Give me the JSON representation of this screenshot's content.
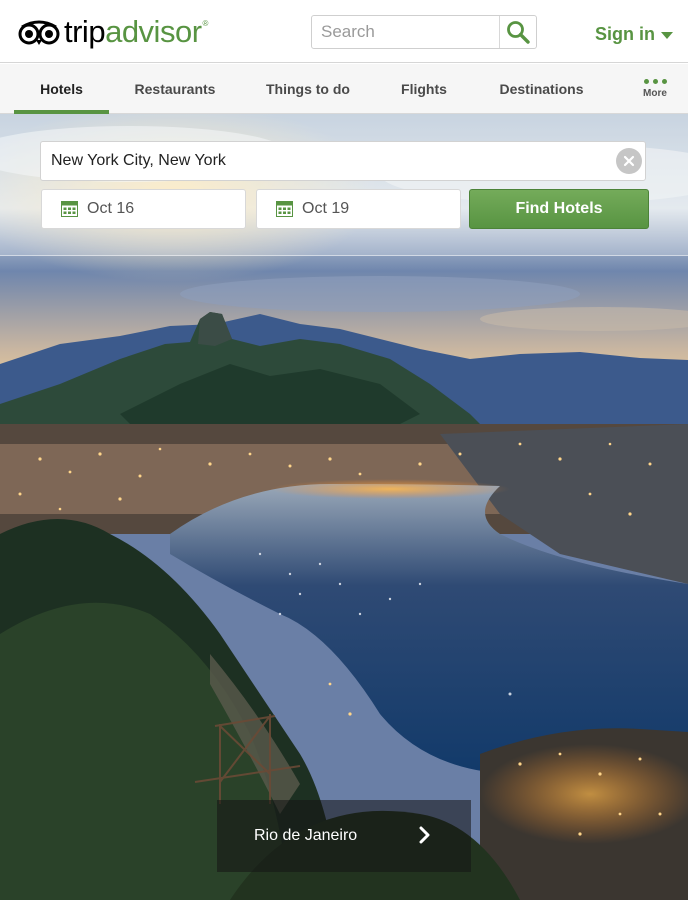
{
  "app": {
    "brand_trip": "trip",
    "brand_advisor": "advisor",
    "brand_mark": "®"
  },
  "header": {
    "search_placeholder": "Search",
    "signin_label": "Sign in"
  },
  "nav": {
    "tabs": [
      {
        "label": "Hotels",
        "active": true
      },
      {
        "label": "Restaurants",
        "active": false
      },
      {
        "label": "Things to do",
        "active": false
      },
      {
        "label": "Flights",
        "active": false
      },
      {
        "label": "Destinations",
        "active": false
      }
    ],
    "more_label": "More"
  },
  "hotel_search": {
    "destination": "New York City, New York",
    "checkin": "Oct 16",
    "checkout": "Oct 19",
    "submit_label": "Find Hotels"
  },
  "featured": {
    "caption": "Rio de Janeiro"
  },
  "colors": {
    "brand_green": "#589442",
    "nav_bg": "#f6f6f6"
  },
  "icons": {
    "logo": "owl-eyes-icon",
    "search": "search-icon",
    "signin_menu": "chevron-down-icon",
    "more": "more-dots-icon",
    "clear": "clear-icon",
    "calendar": "calendar-icon",
    "next": "chevron-right-icon"
  }
}
